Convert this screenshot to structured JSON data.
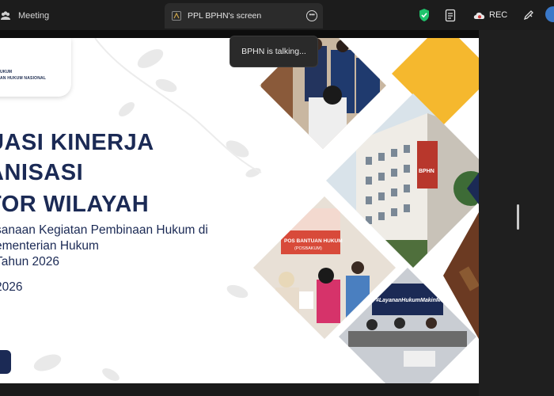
{
  "topbar": {
    "meeting_label": "Meeting",
    "tab_title": "PPL BPHN's screen",
    "rec_label": "REC",
    "shield_color": "#1fc26b"
  },
  "tooltip": {
    "text": "BPHN is talking..."
  },
  "slide": {
    "logo": {
      "line1": "UKUM",
      "line2": "AN HUKUM NASIONAL"
    },
    "title_lines": [
      "UASI KINERJA",
      "ANISASI",
      "TOR WILAYAH"
    ],
    "subtitle_lines": [
      "sanaan Kegiatan Pembinaan Hukum di",
      "ementerian Hukum",
      "Tahun 2026"
    ],
    "year": "2026",
    "photo_texts": {
      "building_sign": "BPHN",
      "pos_title": "POS BANTUAN HUKUM",
      "pos_sub": "(POSBAKUM)",
      "hashtag": "#LayananHukumMakinMudah"
    },
    "accent_color": "#f5b82e",
    "navy_color": "#1b2a55"
  }
}
